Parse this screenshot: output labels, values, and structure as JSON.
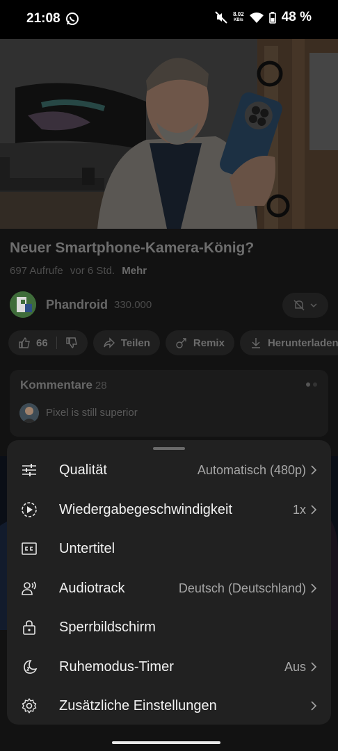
{
  "status_bar": {
    "time": "21:08",
    "net_speed_value": "8.02",
    "net_speed_unit": "KB/s",
    "battery_percent": "48 %"
  },
  "video": {
    "title": "Neuer Smartphone-Kamera-König?",
    "views": "697 Aufrufe",
    "age": "vor 6 Std.",
    "more_label": "Mehr"
  },
  "channel": {
    "name": "Phandroid",
    "subscribers": "330.000"
  },
  "actions": {
    "likes": "66",
    "share_label": "Teilen",
    "remix_label": "Remix",
    "download_label": "Herunterladen"
  },
  "comments": {
    "title": "Kommentare",
    "count": "28",
    "preview_text": "Pixel is still superior"
  },
  "settings_sheet": {
    "items": [
      {
        "label": "Qualität",
        "value": "Automatisch (480p)",
        "icon": "sliders-icon"
      },
      {
        "label": "Wiedergabegeschwindigkeit",
        "value": "1x",
        "icon": "playback-speed-icon"
      },
      {
        "label": "Untertitel",
        "value": "",
        "icon": "closed-captions-icon"
      },
      {
        "label": "Audiotrack",
        "value": "Deutsch (Deutschland)",
        "icon": "audio-track-icon"
      },
      {
        "label": "Sperrbildschirm",
        "value": "",
        "icon": "lock-icon"
      },
      {
        "label": "Ruhemodus-Timer",
        "value": "Aus",
        "icon": "sleep-timer-icon"
      },
      {
        "label": "Zusätzliche Einstellungen",
        "value": "",
        "icon": "gear-icon"
      }
    ]
  },
  "colors": {
    "sheet_bg": "#212121",
    "page_bg": "#121212",
    "label_text": "#f1f1f1",
    "value_text": "#a6a6a6"
  }
}
